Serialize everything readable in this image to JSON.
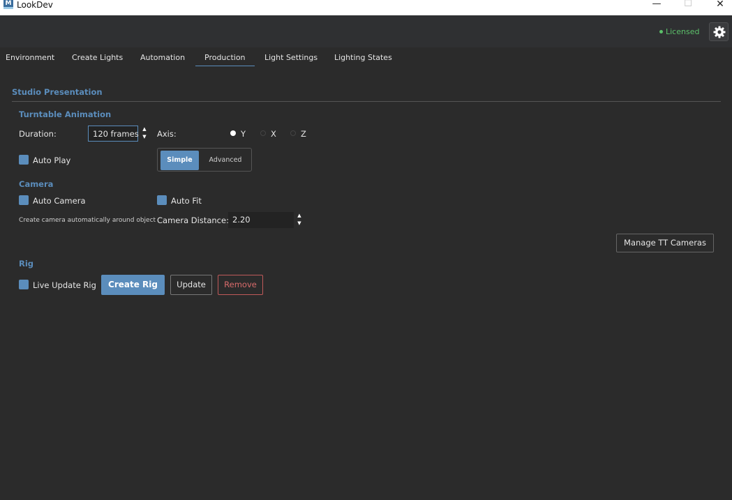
{
  "window": {
    "title": "LookDev",
    "app_icon": "M",
    "min_glyph": "—",
    "max_glyph": "☐",
    "close_glyph": "✕"
  },
  "header": {
    "status": "Licensed",
    "status_color": "#5cc06a",
    "settings_icon": "gear-icon"
  },
  "tabs": [
    {
      "label": "Environment"
    },
    {
      "label": "Create Lights"
    },
    {
      "label": "Automation"
    },
    {
      "label": "Production",
      "active": true
    },
    {
      "label": "Light Settings"
    },
    {
      "label": "Lighting States"
    }
  ],
  "studio": {
    "title": "Studio Presentation",
    "turntable": {
      "title": "Turntable Animation",
      "duration_label": "Duration:",
      "duration_value": "120 frames",
      "axis_label": "Axis:",
      "axis_options": [
        "Y",
        "X",
        "Z"
      ],
      "axis_selected": "Y",
      "auto_play_label": "Auto Play",
      "auto_play_checked": true,
      "mode_options": [
        "Simple",
        "Advanced"
      ],
      "mode_selected": "Simple"
    },
    "camera": {
      "title": "Camera",
      "auto_camera_label": "Auto Camera",
      "auto_camera_checked": true,
      "auto_camera_hint": "Create camera automatically around object",
      "auto_fit_label": "Auto Fit",
      "auto_fit_checked": true,
      "distance_label": "Camera Distance:",
      "distance_value": "2.20",
      "manage_button": "Manage TT Cameras"
    },
    "rig": {
      "title": "Rig",
      "live_update_label": "Live Update Rig",
      "live_update_checked": true,
      "create_button": "Create Rig",
      "update_button": "Update",
      "remove_button": "Remove"
    }
  },
  "colors": {
    "accent": "#5b8dbc",
    "background": "#2b2b2b",
    "danger": "#d96b6b"
  }
}
